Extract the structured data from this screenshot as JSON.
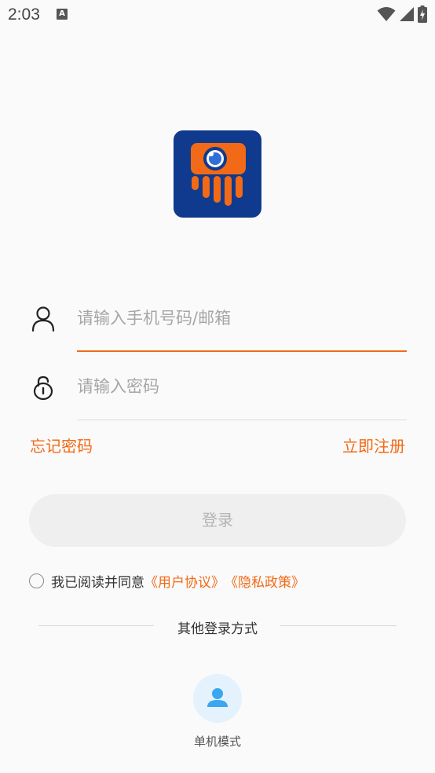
{
  "status_bar": {
    "time": "2:03",
    "notification_icon": "A",
    "icons": [
      "wifi-icon",
      "signal-icon",
      "battery-charging-icon"
    ]
  },
  "logo": {
    "icon": "camera-app-logo",
    "background": "#0f3a8d",
    "accent": "#f26a17"
  },
  "form": {
    "account_placeholder": "请输入手机号码/邮箱",
    "account_value": "",
    "password_placeholder": "请输入密码",
    "password_value": "",
    "account_icon": "user-icon",
    "password_icon": "lock-icon"
  },
  "links": {
    "forgot_password": "忘记密码",
    "register": "立即注册"
  },
  "login_button": "登录",
  "agreement": {
    "checked": false,
    "prefix": "我已阅读并同意",
    "user_agreement": "《用户协议》",
    "privacy_policy": "《隐私政策》"
  },
  "other_login": {
    "title": "其他登录方式",
    "single_mode_label": "单机模式",
    "single_mode_icon": "person-icon"
  },
  "colors": {
    "accent": "#f26a17",
    "background": "#fafafa",
    "button_bg": "#efefef",
    "button_text": "#b4b4b4",
    "single_mode_bg": "#e3f2fc",
    "single_mode_icon": "#3aa7ef"
  }
}
